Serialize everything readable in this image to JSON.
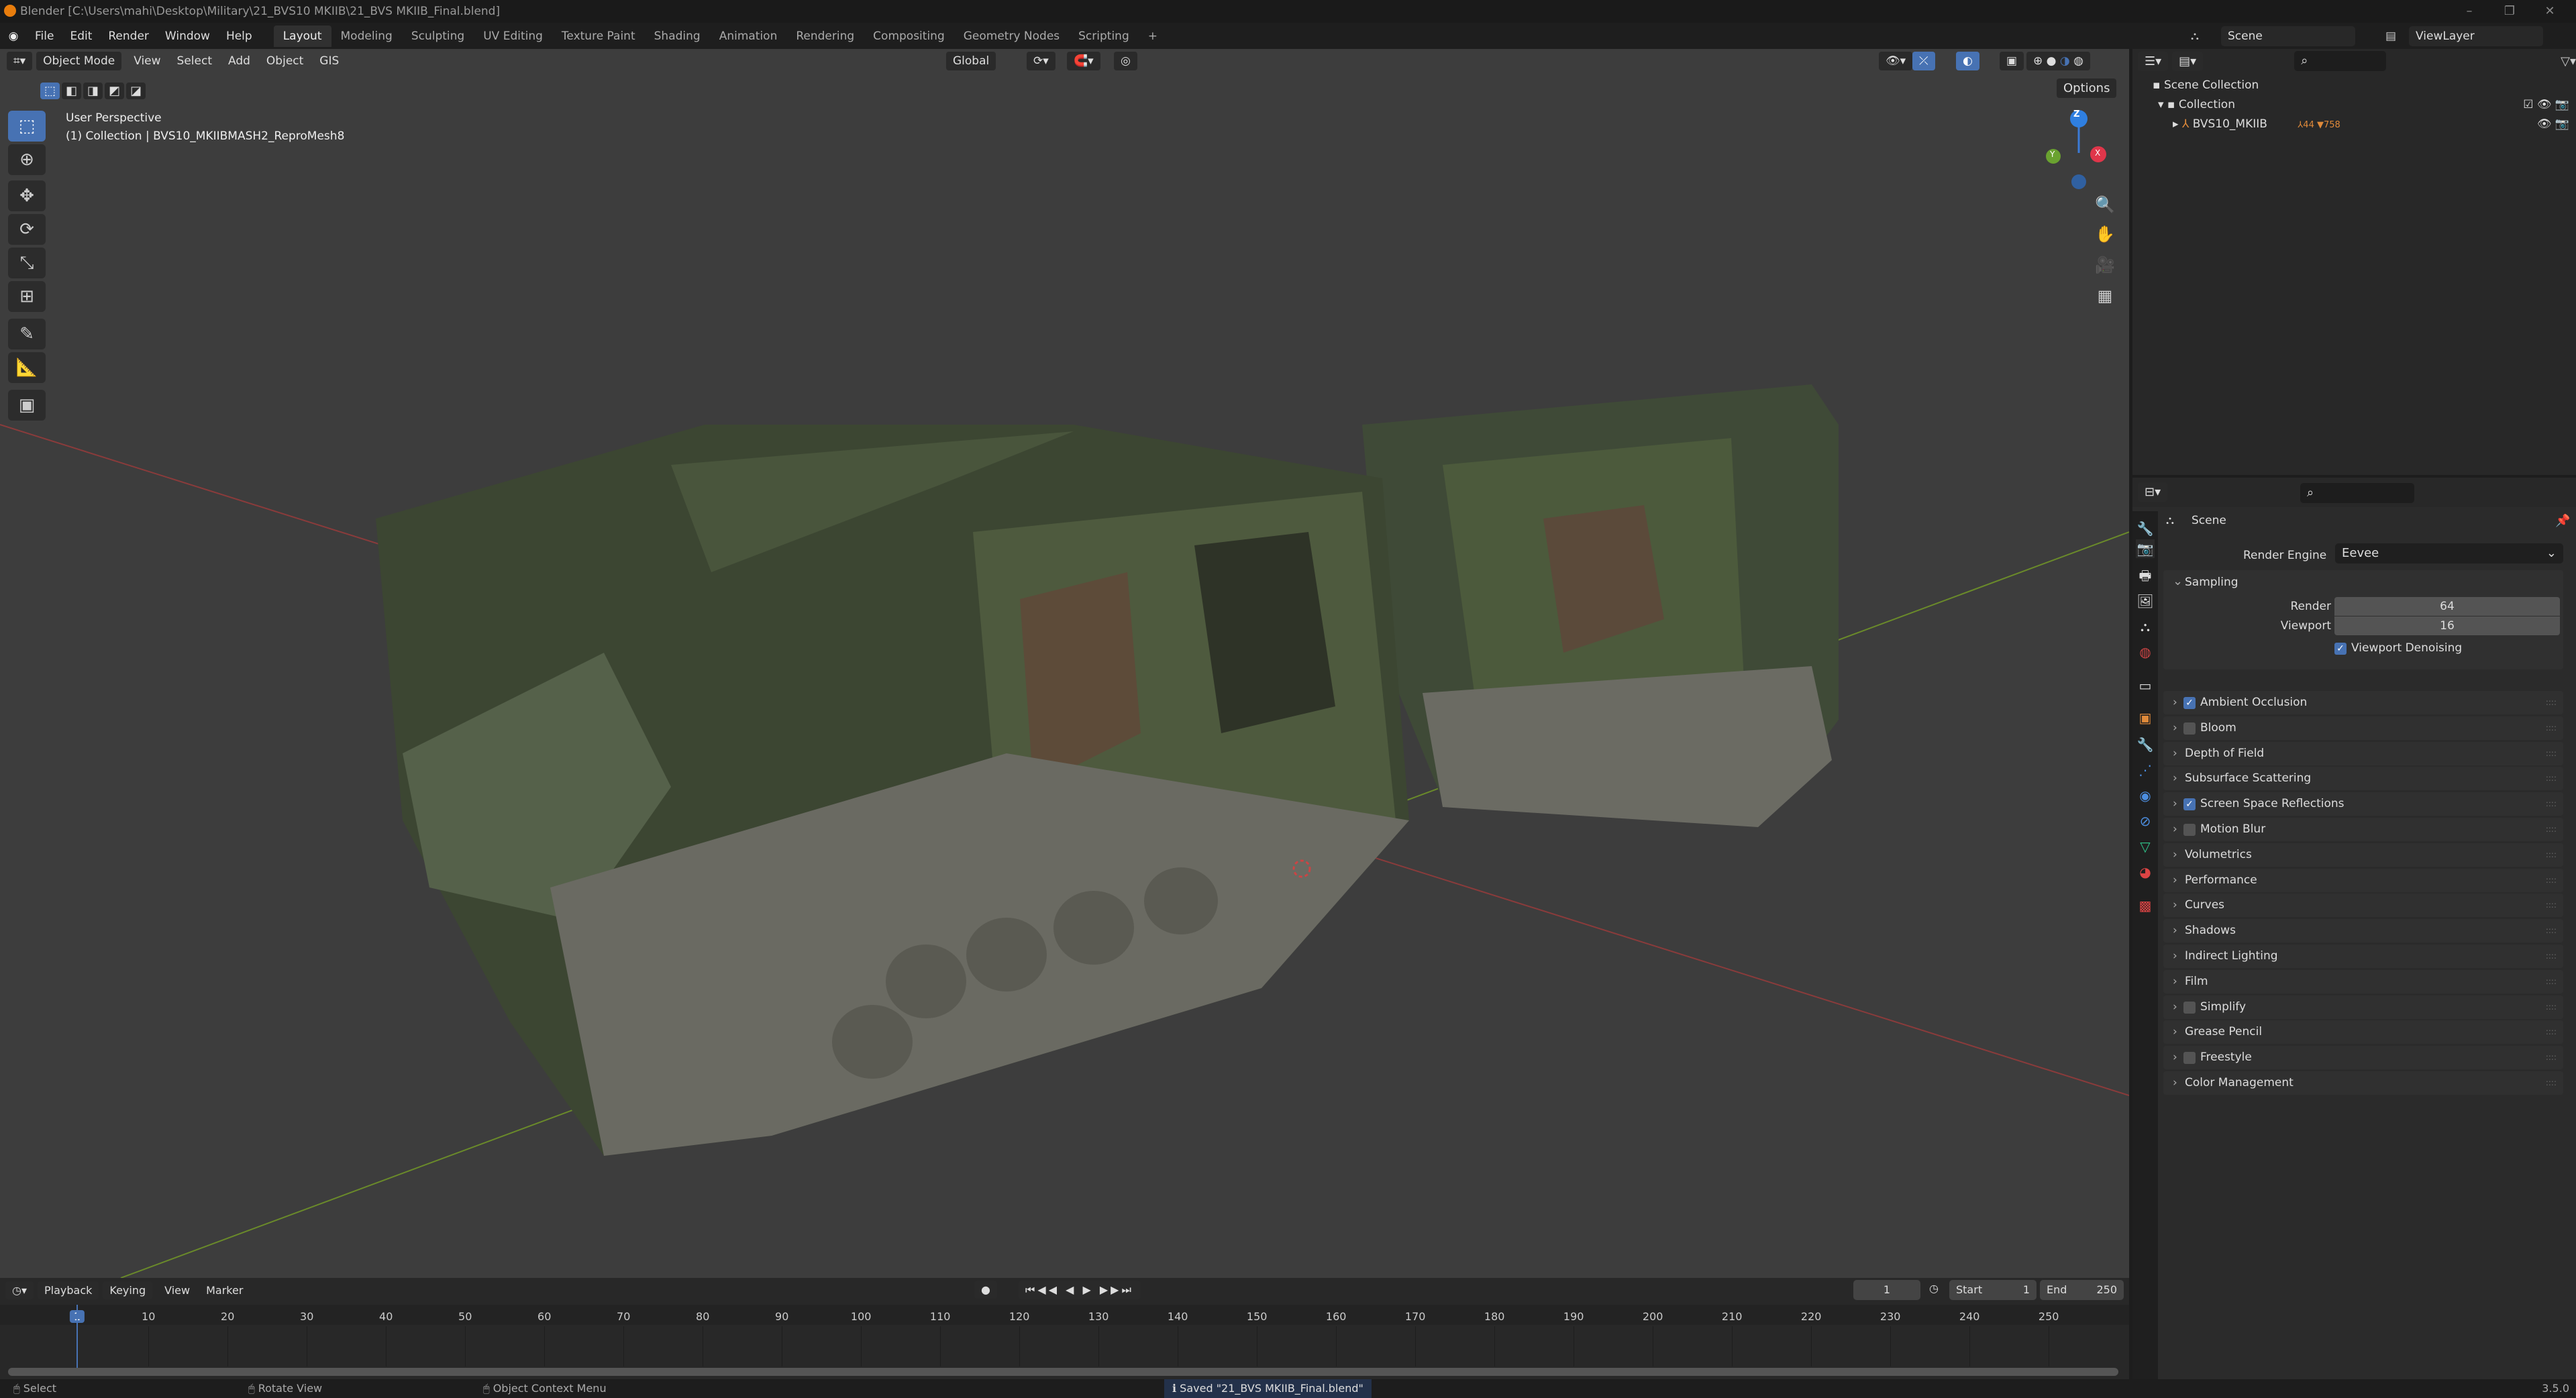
{
  "title": "Blender [C:\\Users\\mahi\\Desktop\\Military\\21_BVS10 MKIIB\\21_BVS MKIIB_Final.blend]",
  "menus": [
    "File",
    "Edit",
    "Render",
    "Window",
    "Help"
  ],
  "workspaces": [
    "Layout",
    "Modeling",
    "Sculpting",
    "UV Editing",
    "Texture Paint",
    "Shading",
    "Animation",
    "Rendering",
    "Compositing",
    "Geometry Nodes",
    "Scripting",
    "+"
  ],
  "scene": "Scene",
  "view_layer": "ViewLayer",
  "viewport": {
    "mode": "Object Mode",
    "menus": [
      "View",
      "Select",
      "Add",
      "Object",
      "GIS"
    ],
    "orientation": "Global",
    "options": "Options",
    "perspective": "User Perspective",
    "collection_info": "(1) Collection | BVS10_MKIIBMASH2_ReproMesh8",
    "gizmo": {
      "z": "Z",
      "y": "Y",
      "x": "X"
    }
  },
  "outliner": {
    "scene_collection": "Scene Collection",
    "collection": "Collection",
    "object": "BVS10_MKIIB",
    "badge1": "44",
    "badge2": "758"
  },
  "properties": {
    "context": "Scene",
    "render_engine_label": "Render Engine",
    "render_engine": "Eevee",
    "sampling": "Sampling",
    "render_label": "Render",
    "render_value": "64",
    "viewport_label": "Viewport",
    "viewport_value": "16",
    "denoise": "Viewport Denoising",
    "panels": [
      {
        "label": "Ambient Occlusion",
        "checkbox": true
      },
      {
        "label": "Bloom",
        "checkbox": false
      },
      {
        "label": "Depth of Field"
      },
      {
        "label": "Subsurface Scattering"
      },
      {
        "label": "Screen Space Reflections",
        "checkbox": true
      },
      {
        "label": "Motion Blur",
        "checkbox": false
      },
      {
        "label": "Volumetrics"
      },
      {
        "label": "Performance"
      },
      {
        "label": "Curves"
      },
      {
        "label": "Shadows"
      },
      {
        "label": "Indirect Lighting"
      },
      {
        "label": "Film"
      },
      {
        "label": "Simplify",
        "checkbox": false
      },
      {
        "label": "Grease Pencil"
      },
      {
        "label": "Freestyle",
        "checkbox": false
      },
      {
        "label": "Color Management"
      }
    ]
  },
  "timeline": {
    "menus": [
      "Playback",
      "Keying",
      "View",
      "Marker"
    ],
    "current_frame": "1",
    "start_label": "Start",
    "start": "1",
    "end_label": "End",
    "end": "250",
    "ticks": [
      "1",
      "10",
      "20",
      "30",
      "40",
      "50",
      "60",
      "70",
      "80",
      "90",
      "100",
      "110",
      "120",
      "130",
      "140",
      "150",
      "160",
      "170",
      "180",
      "190",
      "200",
      "210",
      "220",
      "230",
      "240",
      "250"
    ]
  },
  "status": {
    "select": "Select",
    "rotate": "Rotate View",
    "context_menu": "Object Context Menu",
    "message": "Saved \"21_BVS MKIIB_Final.blend\"",
    "version": "3.5.0"
  },
  "colors": {
    "accent": "#4772b3",
    "viewport_bg": "#3d3d3d",
    "camo_green": "#4a5a3a"
  }
}
